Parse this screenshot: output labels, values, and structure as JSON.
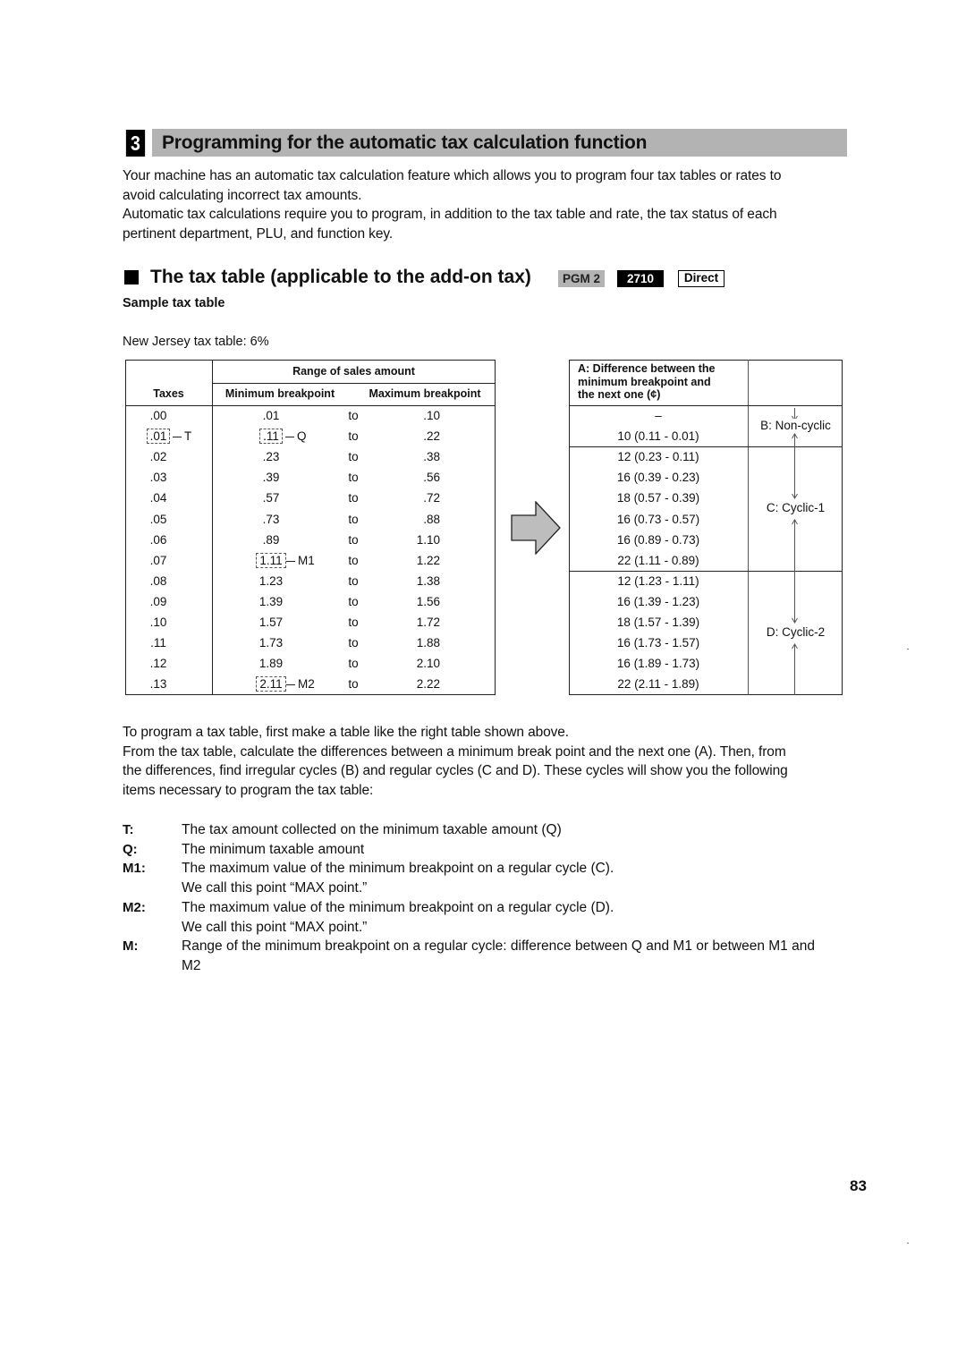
{
  "section": {
    "number": "3",
    "title": "Programming for the automatic tax calculation function"
  },
  "intro": {
    "line1": "Your machine has an automatic tax calculation feature which allows you to program four tax tables or rates to",
    "line2": "avoid calculating incorrect tax amounts.",
    "line3": "Automatic tax calculations require you to program, in addition to the tax table and rate, the tax status of each",
    "line4": "pertinent department, PLU, and function key."
  },
  "subsection": {
    "title": "The tax table (applicable to the add-on tax)",
    "keys": {
      "pgm": "PGM 2",
      "code": "2710",
      "mode": "Direct"
    },
    "sample_label": "Sample tax table",
    "table_caption": "New Jersey tax table: 6%"
  },
  "left_table": {
    "group_header": "Range of sales amount",
    "headers": [
      "Taxes",
      "Minimum breakpoint",
      "Maximum breakpoint"
    ],
    "separator": "to",
    "rows": [
      {
        "tax": ".00",
        "min": ".01",
        "max": ".10",
        "tax_marker": "",
        "min_marker": ""
      },
      {
        "tax": ".01",
        "min": ".11",
        "max": ".22",
        "tax_marker": "T",
        "min_marker": "Q"
      },
      {
        "tax": ".02",
        "min": ".23",
        "max": ".38",
        "tax_marker": "",
        "min_marker": ""
      },
      {
        "tax": ".03",
        "min": ".39",
        "max": ".56",
        "tax_marker": "",
        "min_marker": ""
      },
      {
        "tax": ".04",
        "min": ".57",
        "max": ".72",
        "tax_marker": "",
        "min_marker": ""
      },
      {
        "tax": ".05",
        "min": ".73",
        "max": ".88",
        "tax_marker": "",
        "min_marker": ""
      },
      {
        "tax": ".06",
        "min": ".89",
        "max": "1.10",
        "tax_marker": "",
        "min_marker": ""
      },
      {
        "tax": ".07",
        "min": "1.11",
        "max": "1.22",
        "tax_marker": "",
        "min_marker": "M1"
      },
      {
        "tax": ".08",
        "min": "1.23",
        "max": "1.38",
        "tax_marker": "",
        "min_marker": ""
      },
      {
        "tax": ".09",
        "min": "1.39",
        "max": "1.56",
        "tax_marker": "",
        "min_marker": ""
      },
      {
        "tax": ".10",
        "min": "1.57",
        "max": "1.72",
        "tax_marker": "",
        "min_marker": ""
      },
      {
        "tax": ".11",
        "min": "1.73",
        "max": "1.88",
        "tax_marker": "",
        "min_marker": ""
      },
      {
        "tax": ".12",
        "min": "1.89",
        "max": "2.10",
        "tax_marker": "",
        "min_marker": ""
      },
      {
        "tax": ".13",
        "min": "2.11",
        "max": "2.22",
        "tax_marker": "",
        "min_marker": "M2"
      }
    ]
  },
  "right_table": {
    "header_line1": "A: Difference between the",
    "header_line2": "minimum breakpoint and",
    "header_line3": "the next one (¢)",
    "rows": [
      "–",
      "10 (0.11 - 0.01)",
      "12 (0.23 - 0.11)",
      "16 (0.39 - 0.23)",
      "18 (0.57 - 0.39)",
      "16 (0.73 - 0.57)",
      "16 (0.89 - 0.73)",
      "22 (1.11 - 0.89)",
      "12 (1.23 - 1.11)",
      "16 (1.39 - 1.23)",
      "18 (1.57 - 1.39)",
      "16 (1.73 - 1.57)",
      "16 (1.89 - 1.73)",
      "22 (2.11 - 1.89)"
    ],
    "groups": {
      "b": "B: Non-cyclic",
      "c": "C: Cyclic-1",
      "d": "D: Cyclic-2"
    }
  },
  "explanation": {
    "line1": "To program a tax table, first make a table like the right table shown above.",
    "line2": "From the tax table, calculate the differences between a minimum break point and the next one (A).  Then, from",
    "line3": "the differences, find irregular cycles (B) and regular cycles (C and D).  These cycles will show you the following",
    "line4": "items necessary to program the tax table:"
  },
  "definitions": [
    {
      "key": "T:",
      "lines": [
        "The tax amount collected on the minimum taxable amount (Q)"
      ]
    },
    {
      "key": "Q:",
      "lines": [
        "The minimum taxable amount"
      ]
    },
    {
      "key": "M1:",
      "lines": [
        "The maximum value of the minimum breakpoint on a regular cycle (C).",
        "We call this point “MAX point.”"
      ]
    },
    {
      "key": "M2:",
      "lines": [
        "The maximum value of the minimum breakpoint on a regular cycle (D).",
        "We call this point “MAX point.”"
      ]
    },
    {
      "key": "M:",
      "lines": [
        "Range of the minimum breakpoint on a regular cycle: difference between Q and M1 or between M1 and",
        "M2"
      ]
    }
  ],
  "page_number": "83"
}
